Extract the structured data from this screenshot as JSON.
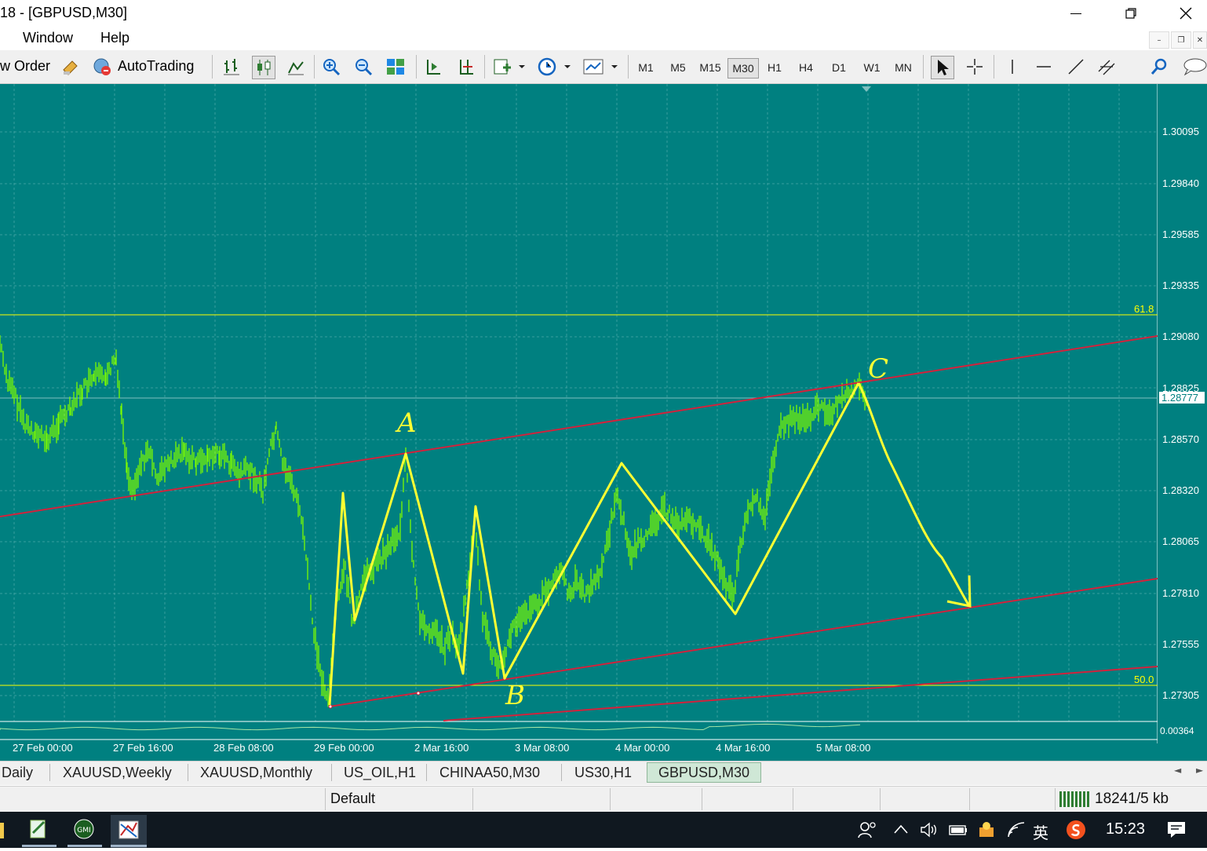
{
  "window": {
    "title": "18 - [GBPUSD,M30]",
    "minimize_icon": "minimize-icon",
    "restore_icon": "restore-icon",
    "close_icon": "close-icon"
  },
  "menu": {
    "items": [
      "Window",
      "Help"
    ]
  },
  "toolbar": {
    "new_order_label": "w Order",
    "autotrading_label": "AutoTrading",
    "timeframes": [
      "M1",
      "M5",
      "M15",
      "M30",
      "H1",
      "H4",
      "D1",
      "W1",
      "MN"
    ],
    "active_timeframe": "M30"
  },
  "chart": {
    "symbol": "GBPUSD,M30",
    "price_labels": [
      "1.30095",
      "1.29840",
      "1.29585",
      "1.29335",
      "1.29080",
      "1.28825",
      "1.28570",
      "1.28320",
      "1.28065",
      "1.27810",
      "1.27555",
      "1.27305"
    ],
    "current_price": "1.28777",
    "indicator_value": "0.00364",
    "fib_levels": [
      {
        "label": "61.8"
      },
      {
        "label": "50.0"
      }
    ],
    "time_labels": [
      "27 Feb 00:00",
      "27 Feb 16:00",
      "28 Feb 08:00",
      "29 Feb 00:00",
      "2 Mar 16:00",
      "3 Mar 08:00",
      "4 Mar 00:00",
      "4 Mar 16:00",
      "5 Mar 08:00"
    ],
    "annotations": [
      "A",
      "B",
      "C"
    ],
    "colors": {
      "background": "#008080",
      "candles": "#7CFC00",
      "channel": "#d2223c",
      "fib": "#ffff00",
      "drawing": "#ffff33"
    }
  },
  "tabs": {
    "items": [
      "Daily",
      "XAUUSD,Weekly",
      "XAUUSD,Monthly",
      "US_OIL,H1",
      "CHINAA50,M30",
      "US30,H1",
      "GBPUSD,M30"
    ],
    "active": "GBPUSD,M30"
  },
  "status": {
    "profile": "Default",
    "traffic": "18241/5 kb"
  },
  "taskbar": {
    "ime": "英",
    "clock": "15:23"
  }
}
